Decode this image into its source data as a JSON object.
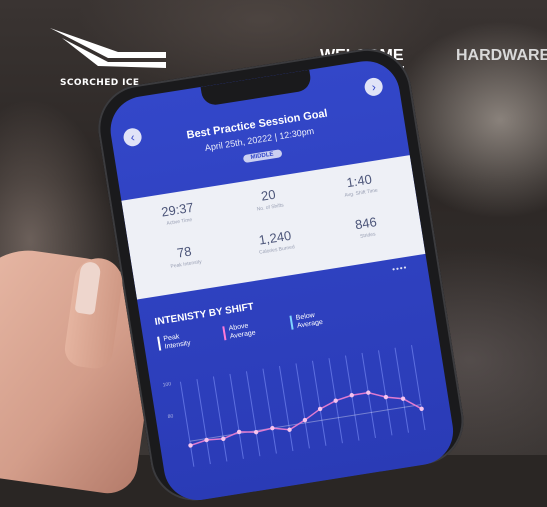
{
  "nav": {
    "brand": "SCORCHED ICE",
    "items": [
      {
        "label": "WELCOME",
        "active": true
      },
      {
        "label": "HARDWARE",
        "active": false
      }
    ]
  },
  "app": {
    "title": "Best Practice Session Goal",
    "date": "April 25th, 20222  |  12:30pm",
    "badge": "MIDDLE",
    "stats": [
      {
        "value": "29:37",
        "label": "Active Time"
      },
      {
        "value": "20",
        "label": "No. of Shifts"
      },
      {
        "value": "1:40",
        "label": "Avg. Shift Time"
      },
      {
        "value": "78",
        "label": "Peak Intensity"
      },
      {
        "value": "1,240",
        "label": "Calories Burned"
      },
      {
        "value": "846",
        "label": "Strides"
      }
    ],
    "dots": "••••",
    "chart": {
      "title": "INTENISTY BY SHIFT",
      "legend": [
        {
          "label": "Peak\nIntensity",
          "color": "#ffffff"
        },
        {
          "label": "Above\nAverage",
          "color": "#ff7ad9"
        },
        {
          "label": "Below\nAverage",
          "color": "#7fd4ff"
        }
      ],
      "yticks": [
        "100",
        "80"
      ],
      "colors": {
        "line": "#e07bd0",
        "grid": "#5d6fe0",
        "point": "#f6c3ee"
      }
    }
  },
  "chart_data": {
    "type": "line",
    "title": "INTENISTY BY SHIFT",
    "x": [
      1,
      2,
      3,
      4,
      5,
      6,
      7,
      8,
      9,
      10,
      11,
      12,
      13,
      14,
      15
    ],
    "series": [
      {
        "values": [
          55,
          57,
          56,
          59,
          57,
          58,
          55,
          60,
          66,
          70,
          72,
          72,
          67,
          64,
          55
        ]
      }
    ],
    "ylim": [
      40,
      100
    ]
  }
}
